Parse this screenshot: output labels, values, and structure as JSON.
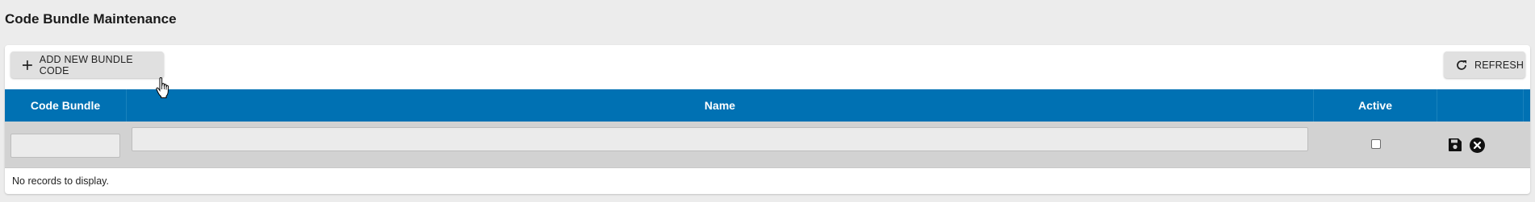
{
  "page": {
    "title": "Code Bundle Maintenance"
  },
  "toolbar": {
    "add_label": "ADD NEW BUNDLE CODE",
    "add_icon": "plus-icon",
    "refresh_label": "REFRESH",
    "refresh_icon": "refresh-icon"
  },
  "grid": {
    "columns": [
      "Code Bundle",
      "Name",
      "Active",
      ""
    ],
    "header_color": "#0071b3",
    "edit_row": {
      "code_bundle_value": "",
      "name_value": "",
      "active_checked": false,
      "actions": [
        "save-icon",
        "cancel-icon"
      ]
    },
    "empty_message": "No records to display."
  }
}
